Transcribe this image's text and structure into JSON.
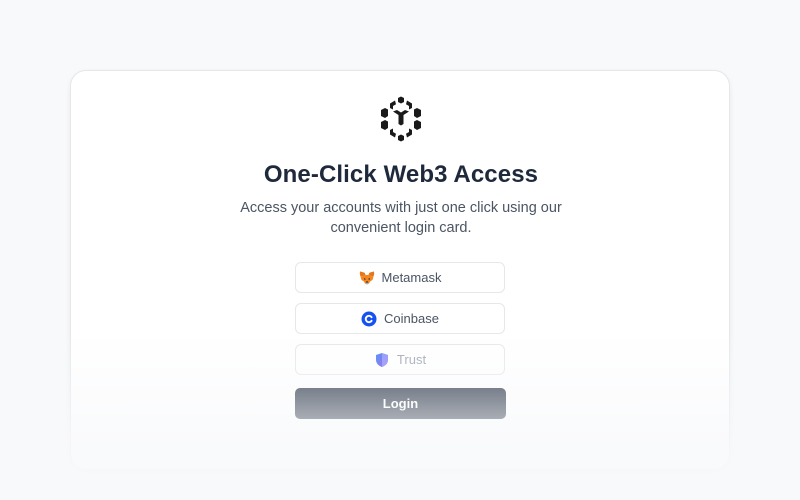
{
  "card": {
    "logo_icon": "cube-logo-icon",
    "title": "One-Click Web3 Access",
    "subtitle": "Access your accounts with just one click using our convenient login card."
  },
  "wallets": [
    {
      "label": "Metamask",
      "icon": "metamask-fox-icon"
    },
    {
      "label": "Coinbase",
      "icon": "coinbase-icon",
      "color": "#1652f0"
    },
    {
      "label": "Trust",
      "icon": "trust-shield-icon",
      "color": "#6366f1"
    }
  ],
  "login": {
    "label": "Login",
    "color": "#1e293b"
  }
}
